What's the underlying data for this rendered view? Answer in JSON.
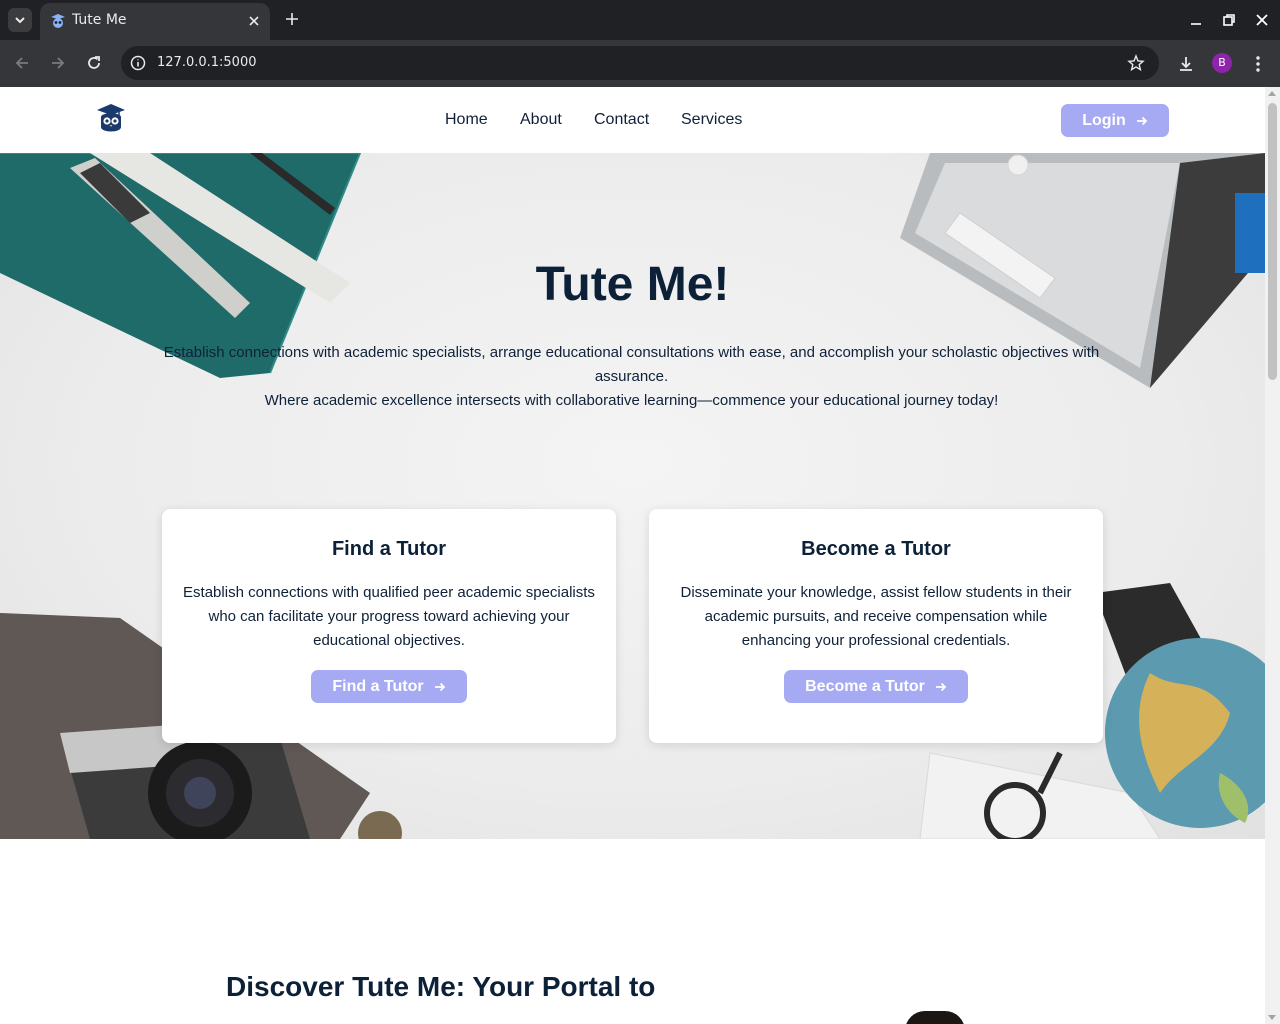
{
  "browser": {
    "tab_title": "Tute Me",
    "url": "127.0.0.1:5000",
    "profile_initial": "B"
  },
  "header": {
    "nav": [
      "Home",
      "About",
      "Contact",
      "Services"
    ],
    "login_label": "Login"
  },
  "hero": {
    "title": "Tute Me!",
    "subtitle_line1": "Establish connections with academic specialists, arrange educational consultations with ease, and accomplish your scholastic objectives with assurance.",
    "subtitle_line2": "Where academic excellence intersects with collaborative learning—commence your educational journey today!"
  },
  "cards": [
    {
      "title": "Find a Tutor",
      "text": "Establish connections with qualified peer academic specialists who can facilitate your progress toward achieving your educational objectives.",
      "button": "Find a Tutor"
    },
    {
      "title": "Become a Tutor",
      "text": "Disseminate your knowledge, assist fellow students in their academic pursuits, and receive compensation while enhancing your professional credentials.",
      "button": "Become a Tutor"
    }
  ],
  "discover": {
    "title": "Discover Tute Me: Your Portal to"
  },
  "colors": {
    "accent": "#a5aaf3",
    "navy": "#0c2038",
    "brand_logo": "#1a3a6b"
  },
  "icons": [
    "tab-list-icon",
    "owl-favicon-icon",
    "close-icon",
    "plus-icon",
    "minimize-icon",
    "restore-icon",
    "back-arrow-icon",
    "forward-arrow-icon",
    "reload-icon",
    "site-info-icon",
    "star-icon",
    "download-icon",
    "kebab-menu-icon",
    "owl-logo-icon",
    "arrow-right-icon"
  ]
}
